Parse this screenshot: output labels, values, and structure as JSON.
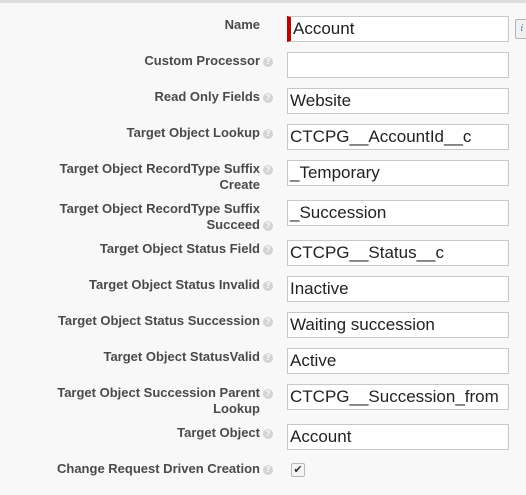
{
  "fields": [
    {
      "label": "Name",
      "value": "Account",
      "required": true,
      "help": false
    },
    {
      "label": "Custom Processor",
      "value": "",
      "required": false,
      "help": true
    },
    {
      "label": "Read Only Fields",
      "value": "Website",
      "required": false,
      "help": true
    },
    {
      "label": "Target Object Lookup",
      "value": "CTCPG__AccountId__c",
      "required": false,
      "help": true
    },
    {
      "label_line1": "Target Object RecordType Suffix",
      "label_line2": "Create",
      "value": "_Temporary",
      "required": false,
      "help": true
    },
    {
      "label_line1": "Target Object RecordType Suffix",
      "label_line2": "Succeed",
      "value": "_Succession",
      "required": false,
      "help": true
    },
    {
      "label": "Target Object Status Field",
      "value": "CTCPG__Status__c",
      "required": false,
      "help": true
    },
    {
      "label": "Target Object Status Invalid",
      "value": "Inactive",
      "required": false,
      "help": true
    },
    {
      "label": "Target Object Status Succession",
      "value": "Waiting succession",
      "required": false,
      "help": true
    },
    {
      "label": "Target Object StatusValid",
      "value": "Active",
      "required": false,
      "help": true
    },
    {
      "label_line1": "Target Object Succession Parent",
      "label_line2": "Lookup",
      "value": "CTCPG__Succession_from",
      "required": false,
      "help": true
    },
    {
      "label": "Target Object",
      "value": "Account",
      "required": false,
      "help": true
    }
  ],
  "checkbox_field": {
    "label": "Change Request Driven Creation",
    "checked": true,
    "check_glyph": "✔"
  },
  "help_glyph": "?",
  "lookup_glyph": "i",
  "colors": {
    "required_bar": "#c00000",
    "help_icon": "#d3d3d3",
    "label": "#4a4a4a"
  }
}
